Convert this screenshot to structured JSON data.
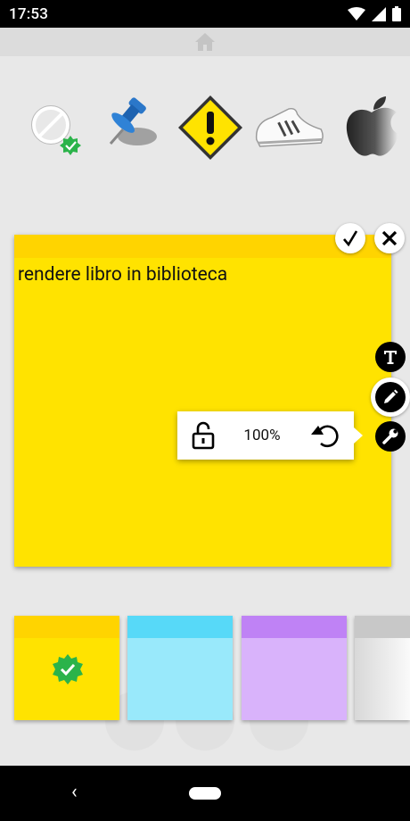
{
  "status_bar": {
    "time": "17:53"
  },
  "note": {
    "text": "rendere libro in biblioteca",
    "background": "#ffe300",
    "header_color": "#ffd400"
  },
  "tool_popup": {
    "zoom_label": "100%"
  },
  "toolbar_icons": [
    "text-format-icon",
    "pencil-icon",
    "wrench-icon"
  ],
  "stickers": [
    "forbidden-verified-sticker",
    "pushpin-sticker",
    "warning-sign-sticker",
    "sneaker-sticker",
    "apple-sticker"
  ],
  "palette": [
    {
      "name": "yellow",
      "body": "#ffe300",
      "head": "#ffd400",
      "selected": true
    },
    {
      "name": "cyan",
      "body": "#99e9fb",
      "head": "#57d9f8",
      "selected": false
    },
    {
      "name": "purple",
      "body": "#d9b3fb",
      "head": "#bf82f5",
      "selected": false
    },
    {
      "name": "gray",
      "body": "#f3f3f3",
      "head": "#d4d4d4",
      "selected": false
    }
  ]
}
